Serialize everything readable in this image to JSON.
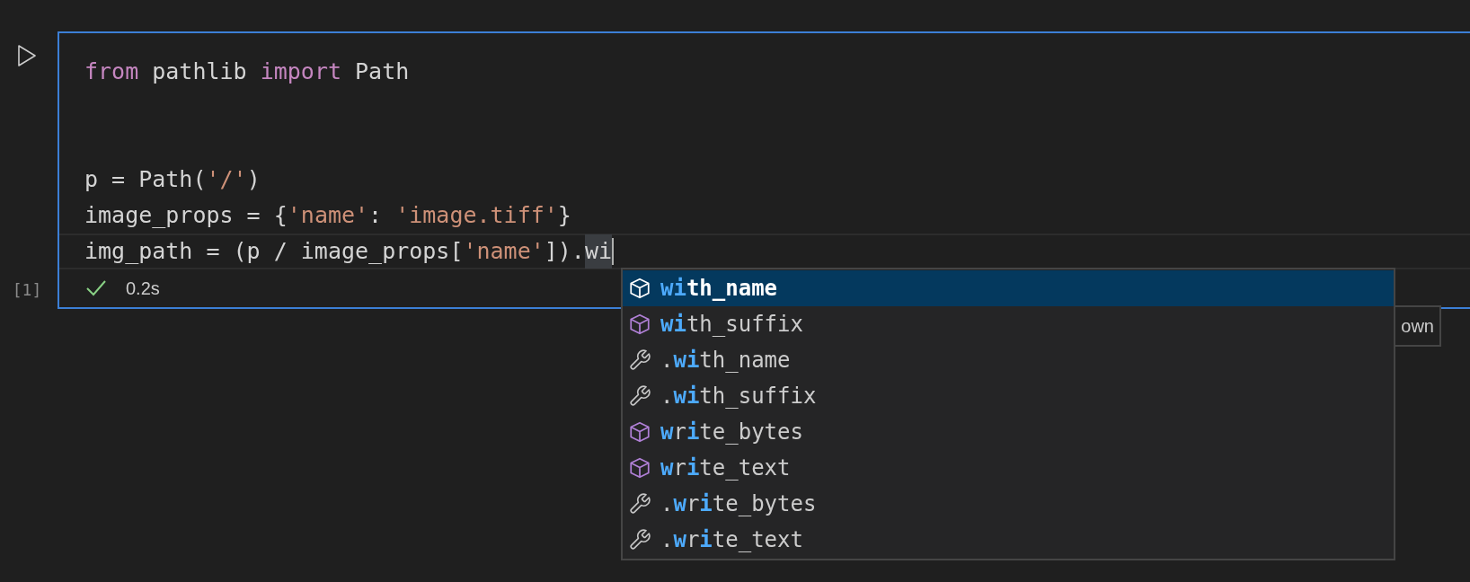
{
  "cell": {
    "execution_count": "[1]",
    "focused": true,
    "code_groups": [
      [
        {
          "current": false,
          "tokens": [
            {
              "text": "from",
              "kind": "keyword"
            },
            {
              "text": " pathlib ",
              "kind": "plain"
            },
            {
              "text": "import",
              "kind": "keyword"
            },
            {
              "text": " Path",
              "kind": "plain"
            }
          ]
        }
      ],
      [
        {
          "current": false,
          "tokens": [
            {
              "text": "p = Path(",
              "kind": "plain"
            },
            {
              "text": "'/'",
              "kind": "string"
            },
            {
              "text": ")",
              "kind": "plain"
            }
          ]
        },
        {
          "current": false,
          "tokens": [
            {
              "text": "image_props = {",
              "kind": "plain"
            },
            {
              "text": "'name'",
              "kind": "string"
            },
            {
              "text": ": ",
              "kind": "plain"
            },
            {
              "text": "'image.tiff'",
              "kind": "string"
            },
            {
              "text": "}",
              "kind": "plain"
            }
          ]
        },
        {
          "current": true,
          "tokens": [
            {
              "text": "img_path = (p / image_props[",
              "kind": "plain"
            },
            {
              "text": "'name'",
              "kind": "string"
            },
            {
              "text": "]).",
              "kind": "plain"
            },
            {
              "text": "wi",
              "kind": "word_highlight"
            }
          ]
        }
      ]
    ],
    "status": {
      "kind": "success",
      "duration": "0.2s"
    }
  },
  "tooltip": {
    "text": "own"
  },
  "suggestions": [
    {
      "kind": "property",
      "selected": true,
      "parts": [
        {
          "text": "wi",
          "match": true
        },
        {
          "text": "th_name",
          "match": false
        }
      ]
    },
    {
      "kind": "property",
      "selected": false,
      "parts": [
        {
          "text": "wi",
          "match": true
        },
        {
          "text": "th_suffix",
          "match": false
        }
      ]
    },
    {
      "kind": "snippet",
      "selected": false,
      "parts": [
        {
          "text": ".",
          "match": false
        },
        {
          "text": "wi",
          "match": true
        },
        {
          "text": "th_name",
          "match": false
        }
      ]
    },
    {
      "kind": "snippet",
      "selected": false,
      "parts": [
        {
          "text": ".",
          "match": false
        },
        {
          "text": "wi",
          "match": true
        },
        {
          "text": "th_suffix",
          "match": false
        }
      ]
    },
    {
      "kind": "property",
      "selected": false,
      "parts": [
        {
          "text": "w",
          "match": true
        },
        {
          "text": "r",
          "match": false
        },
        {
          "text": "i",
          "match": true
        },
        {
          "text": "te_bytes",
          "match": false
        }
      ]
    },
    {
      "kind": "property",
      "selected": false,
      "parts": [
        {
          "text": "w",
          "match": true
        },
        {
          "text": "r",
          "match": false
        },
        {
          "text": "i",
          "match": true
        },
        {
          "text": "te_text",
          "match": false
        }
      ]
    },
    {
      "kind": "snippet",
      "selected": false,
      "parts": [
        {
          "text": ".",
          "match": false
        },
        {
          "text": "w",
          "match": true
        },
        {
          "text": "r",
          "match": false
        },
        {
          "text": "i",
          "match": true
        },
        {
          "text": "te_bytes",
          "match": false
        }
      ]
    },
    {
      "kind": "snippet",
      "selected": false,
      "parts": [
        {
          "text": ".",
          "match": false
        },
        {
          "text": "w",
          "match": true
        },
        {
          "text": "r",
          "match": false
        },
        {
          "text": "i",
          "match": true
        },
        {
          "text": "te_text",
          "match": false
        }
      ]
    }
  ]
}
